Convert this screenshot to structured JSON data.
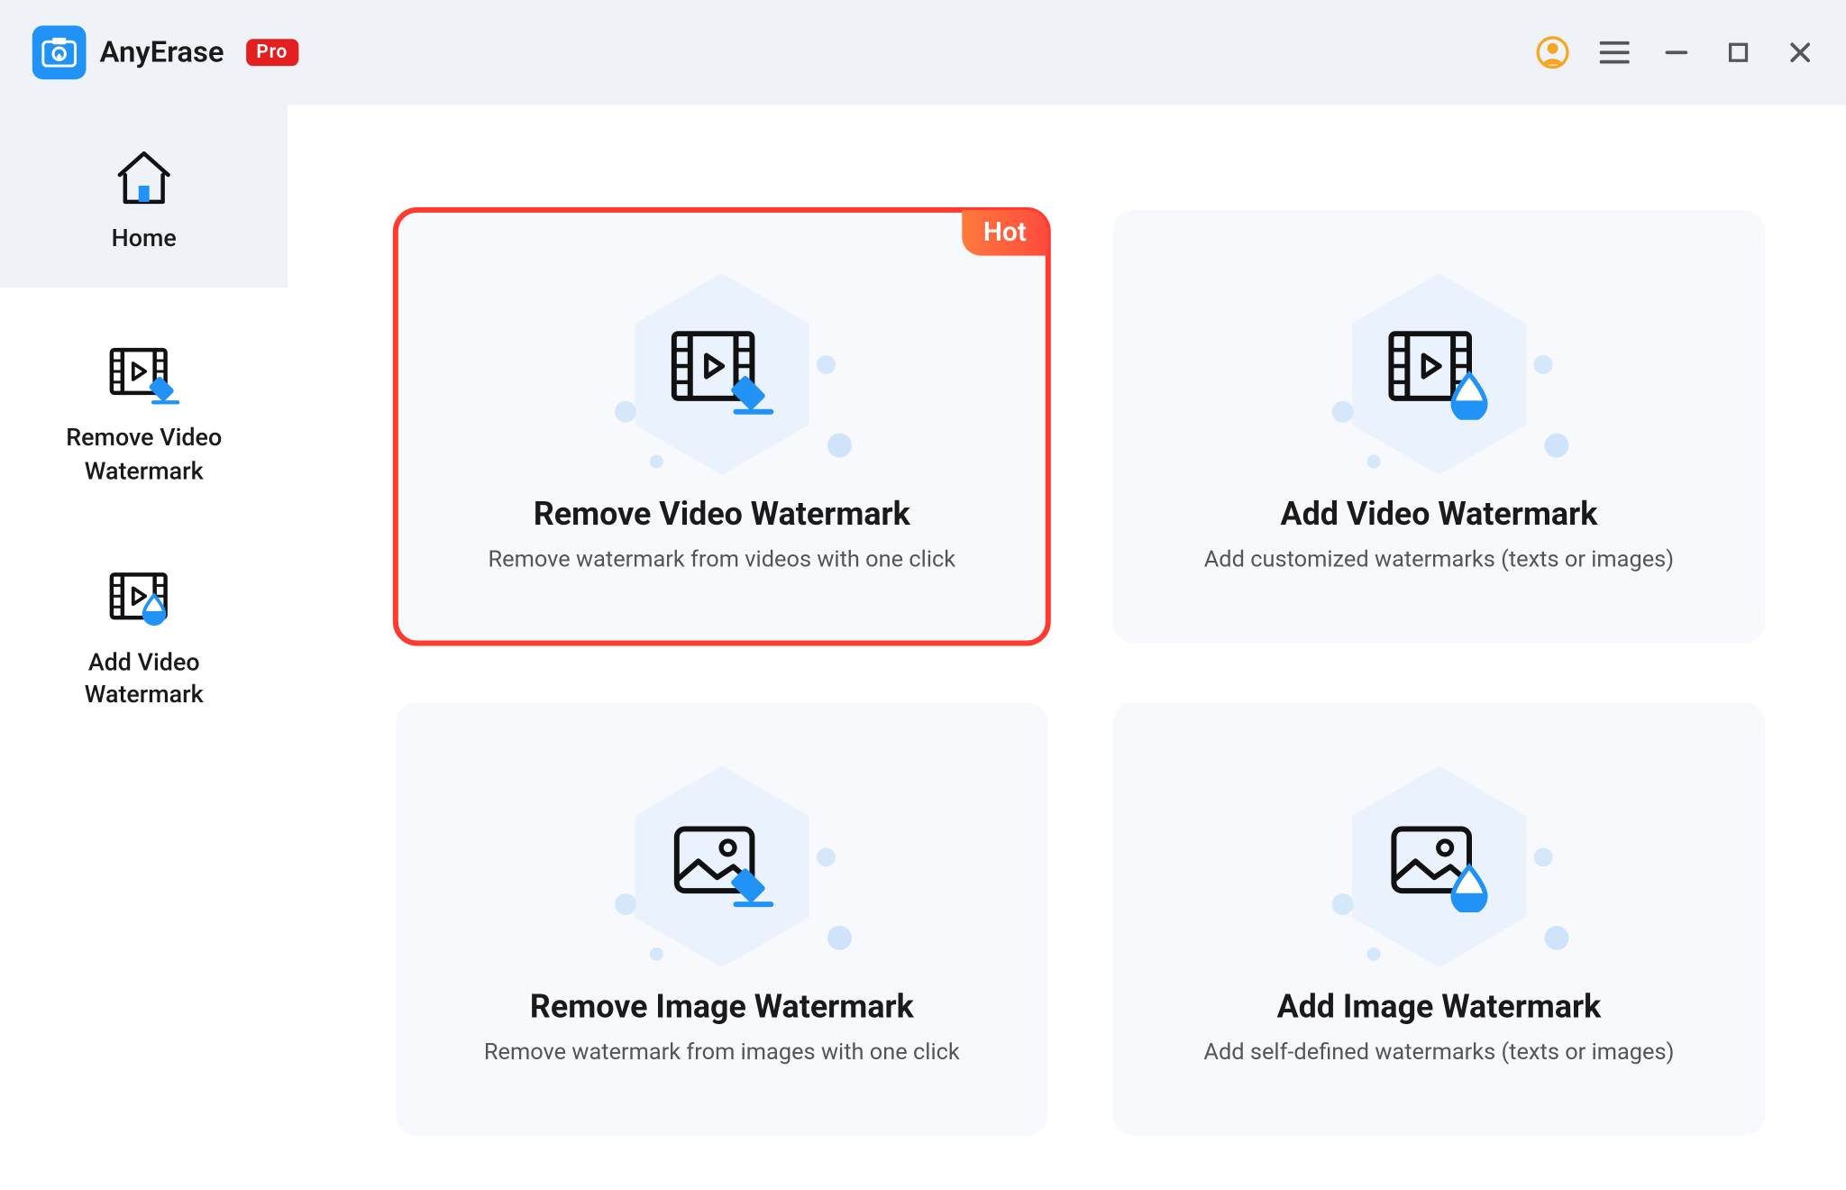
{
  "app": {
    "title": "AnyErase",
    "badge": "Pro"
  },
  "sidebar": {
    "items": [
      {
        "label": "Home"
      },
      {
        "label": "Remove Video\nWatermark"
      },
      {
        "label": "Add Video\nWatermark"
      }
    ]
  },
  "main": {
    "hot_label": "Hot",
    "cards": [
      {
        "title": "Remove Video Watermark",
        "subtitle": "Remove watermark from videos with one click"
      },
      {
        "title": "Add Video Watermark",
        "subtitle": "Add customized watermarks (texts or images)"
      },
      {
        "title": "Remove Image Watermark",
        "subtitle": "Remove watermark from images with one click"
      },
      {
        "title": "Add Image Watermark",
        "subtitle": "Add self-defined watermarks  (texts or images)"
      }
    ]
  }
}
